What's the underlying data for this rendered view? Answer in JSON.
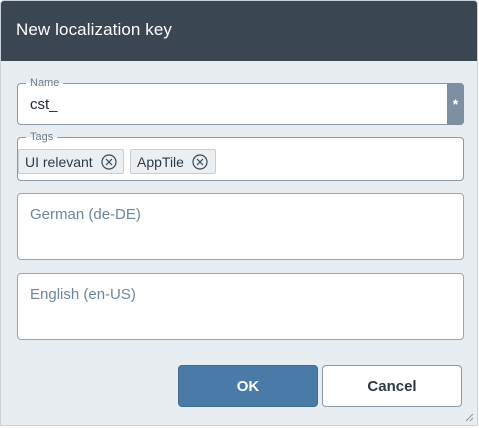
{
  "dialog": {
    "title": "New localization key"
  },
  "name_field": {
    "legend": "Name",
    "value": "cst_",
    "required_marker": "*"
  },
  "tags_field": {
    "legend": "Tags",
    "tags": [
      {
        "label": "UI relevant",
        "remove_icon": "circle-x-icon"
      },
      {
        "label": "AppTile",
        "remove_icon": "circle-x-icon"
      }
    ]
  },
  "german_field": {
    "placeholder": "German (de-DE)"
  },
  "english_field": {
    "placeholder": "English (en-US)"
  },
  "buttons": {
    "ok_label": "OK",
    "cancel_label": "Cancel"
  },
  "colors": {
    "titlebar": "#3a4753",
    "dialog_background": "#e8edf2",
    "primary_button": "#4a7aa8",
    "placeholder_text": "#6d86a0"
  }
}
